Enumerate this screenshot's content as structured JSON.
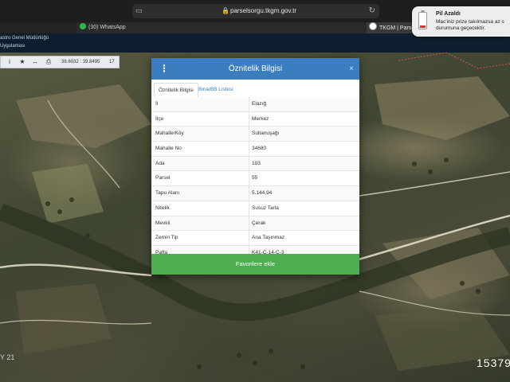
{
  "browser": {
    "url": "parselsorgu.tkgm.gov.tr",
    "tabs": {
      "left_label": "",
      "whatsapp_label": "(30) WhatsApp",
      "tkgm_label": "TKGM | Parsel S"
    }
  },
  "site_header": {
    "line1": "astro Genel Müdürlüğü",
    "line2": "Uygulaması"
  },
  "map_toolbar": {
    "coords": "38.6032 : 39.8495",
    "zoom": "17"
  },
  "map_overlay": {
    "bottom_left_text": "Y 21",
    "bottom_right_text": "15379"
  },
  "notification": {
    "title": "Pil Azaldı",
    "body": "Mac'iniz prize takılmazsa az s durumuna geçecektir."
  },
  "modal": {
    "title": "Öznitelik Bilgisi",
    "close_glyph": "×",
    "menu_glyph": "⋮",
    "tabs": [
      {
        "label": "Öznitelik Bilgisi",
        "active": true
      },
      {
        "label": "Bina/BB Listesi",
        "active": false
      }
    ],
    "rows": [
      {
        "key": "İl",
        "value": "Elazığ"
      },
      {
        "key": "İlçe",
        "value": "Merkez"
      },
      {
        "key": "Mahalle/Köy",
        "value": "Sultanuşağı"
      },
      {
        "key": "Mahalle No",
        "value": "34680"
      },
      {
        "key": "Ada",
        "value": "103"
      },
      {
        "key": "Parsel",
        "value": "55"
      },
      {
        "key": "Tapu Alanı",
        "value": "5.144,94"
      },
      {
        "key": "Nitelik",
        "value": "Susuz Tarla"
      },
      {
        "key": "Mevkii",
        "value": "Çerak"
      },
      {
        "key": "Zemin Tip",
        "value": "Ana Taşınmaz"
      },
      {
        "key": "Pafta",
        "value": "K41-C-14-C-3"
      }
    ],
    "favorite_button": "Favorilere ekle"
  },
  "colors": {
    "modal_header": "#3a7ec0",
    "favorite_button": "#4cae4f",
    "battery_low": "#e0312c"
  }
}
